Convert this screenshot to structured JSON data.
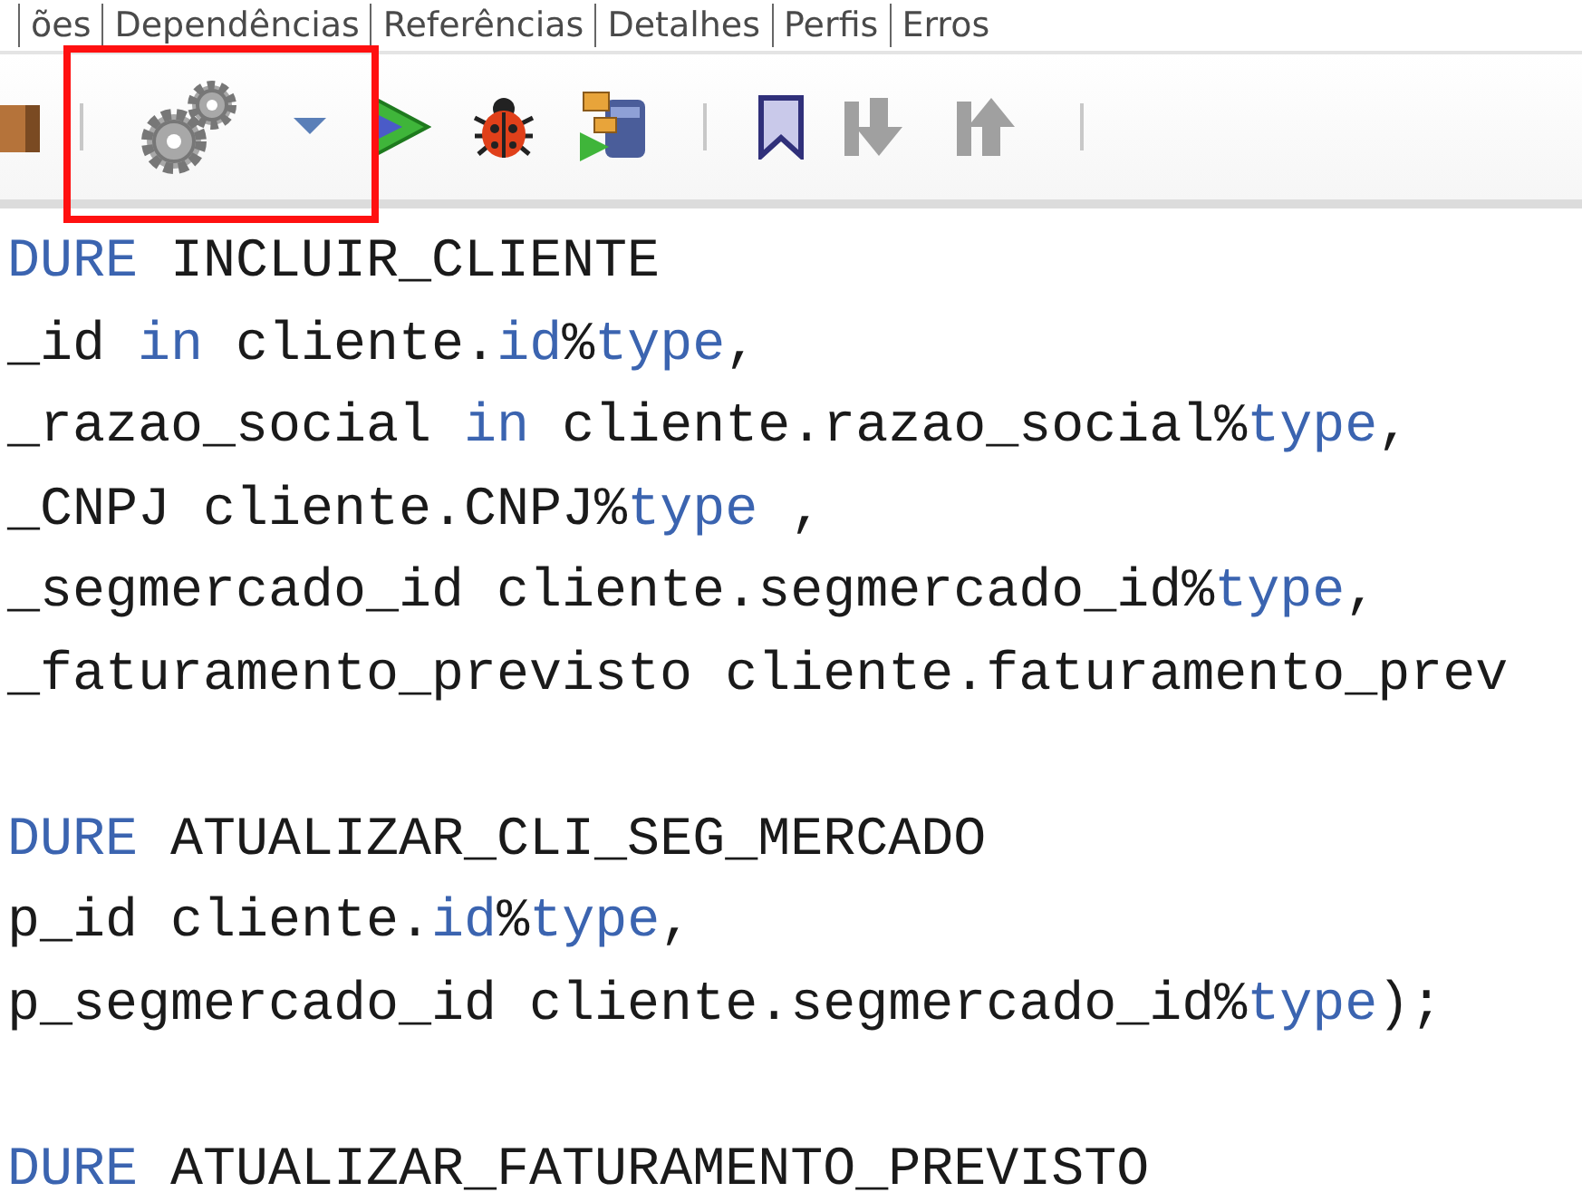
{
  "tabs": [
    {
      "label": "ões"
    },
    {
      "label": "Dependências"
    },
    {
      "label": "Referências"
    },
    {
      "label": "Detalhes"
    },
    {
      "label": "Perfis"
    },
    {
      "label": "Erros"
    }
  ],
  "toolbar": [
    {
      "kind": "package"
    },
    {
      "kind": "separator"
    },
    {
      "kind": "gears"
    },
    {
      "kind": "caret"
    },
    {
      "kind": "run"
    },
    {
      "kind": "debug"
    },
    {
      "kind": "db-run"
    },
    {
      "kind": "separator"
    },
    {
      "kind": "bookmark"
    },
    {
      "kind": "next"
    },
    {
      "kind": "previous"
    },
    {
      "kind": "separator"
    }
  ],
  "code_lines": [
    {
      "kind": "code",
      "segments": [
        {
          "kind": "keyword",
          "text": "DURE"
        },
        {
          "kind": "plain",
          "text": " INCLUIR_CLIENTE"
        }
      ]
    },
    {
      "kind": "code",
      "segments": [
        {
          "kind": "plain",
          "text": "_id "
        },
        {
          "kind": "keyword",
          "text": "in"
        },
        {
          "kind": "plain",
          "text": " cliente."
        },
        {
          "kind": "keyword",
          "text": "id"
        },
        {
          "kind": "plain",
          "text": "%"
        },
        {
          "kind": "keyword",
          "text": "type"
        },
        {
          "kind": "plain",
          "text": ","
        }
      ]
    },
    {
      "kind": "code",
      "segments": [
        {
          "kind": "plain",
          "text": "_razao_social "
        },
        {
          "kind": "keyword",
          "text": "in"
        },
        {
          "kind": "plain",
          "text": " cliente.razao_social%"
        },
        {
          "kind": "keyword",
          "text": "type"
        },
        {
          "kind": "plain",
          "text": ","
        }
      ]
    },
    {
      "kind": "code",
      "segments": [
        {
          "kind": "plain",
          "text": "_CNPJ cliente.CNPJ%"
        },
        {
          "kind": "keyword",
          "text": "type"
        },
        {
          "kind": "plain",
          "text": " ,"
        }
      ]
    },
    {
      "kind": "code",
      "segments": [
        {
          "kind": "plain",
          "text": "_segmercado_id cliente.segmercado_id%"
        },
        {
          "kind": "keyword",
          "text": "type"
        },
        {
          "kind": "plain",
          "text": ","
        }
      ]
    },
    {
      "kind": "code",
      "segments": [
        {
          "kind": "plain",
          "text": "_faturamento_previsto cliente.faturamento_prev"
        }
      ]
    },
    {
      "kind": "blank"
    },
    {
      "kind": "code",
      "segments": [
        {
          "kind": "keyword",
          "text": "DURE"
        },
        {
          "kind": "plain",
          "text": " ATUALIZAR_CLI_SEG_MERCADO"
        }
      ]
    },
    {
      "kind": "code",
      "segments": [
        {
          "kind": "plain",
          "text": "p_id cliente."
        },
        {
          "kind": "keyword",
          "text": "id"
        },
        {
          "kind": "plain",
          "text": "%"
        },
        {
          "kind": "keyword",
          "text": "type"
        },
        {
          "kind": "plain",
          "text": ","
        }
      ]
    },
    {
      "kind": "code",
      "segments": [
        {
          "kind": "plain",
          "text": "p_segmercado_id cliente.segmercado_id%"
        },
        {
          "kind": "keyword",
          "text": "type"
        },
        {
          "kind": "plain",
          "text": ");"
        }
      ]
    },
    {
      "kind": "blank"
    },
    {
      "kind": "code",
      "segments": [
        {
          "kind": "keyword",
          "text": "DURE"
        },
        {
          "kind": "plain",
          "text": " ATUALIZAR_FATURAMENTO_PREVISTO"
        }
      ]
    }
  ]
}
